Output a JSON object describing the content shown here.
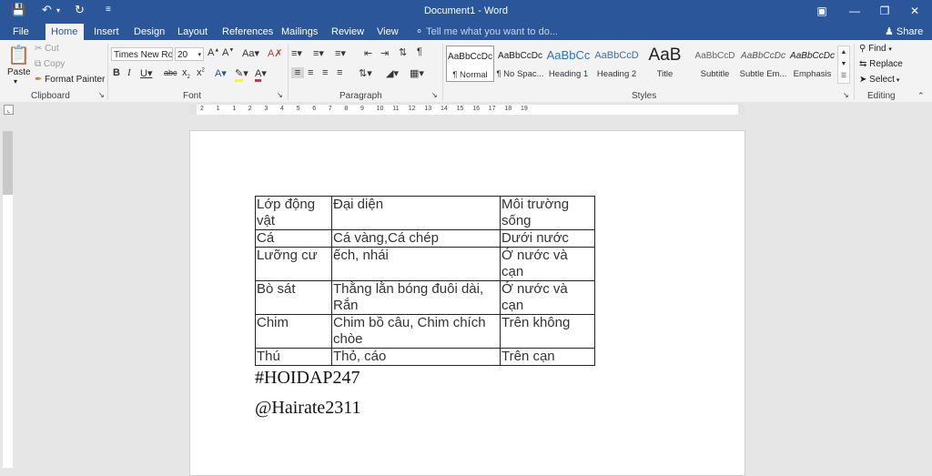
{
  "window": {
    "title": "Document1 - Word",
    "share_label": "Share"
  },
  "tabs": [
    {
      "label": "File"
    },
    {
      "label": "Home"
    },
    {
      "label": "Insert"
    },
    {
      "label": "Design"
    },
    {
      "label": "Layout"
    },
    {
      "label": "References"
    },
    {
      "label": "Mailings"
    },
    {
      "label": "Review"
    },
    {
      "label": "View"
    }
  ],
  "tell_me": "Tell me what you want to do...",
  "clipboard": {
    "paste": "Paste",
    "cut": "Cut",
    "copy": "Copy",
    "format_painter": "Format Painter",
    "group": "Clipboard"
  },
  "font": {
    "name": "Times New Ro",
    "size": "20",
    "group": "Font"
  },
  "paragraph": {
    "group": "Paragraph"
  },
  "styles": {
    "group": "Styles",
    "items": [
      {
        "sample": "AaBbCcDc",
        "name": "¶ Normal"
      },
      {
        "sample": "AaBbCcDc",
        "name": "¶ No Spac..."
      },
      {
        "sample": "AaBbCc",
        "name": "Heading 1"
      },
      {
        "sample": "AaBbCcD",
        "name": "Heading 2"
      },
      {
        "sample": "AaB",
        "name": "Title"
      },
      {
        "sample": "AaBbCcD",
        "name": "Subtitle"
      },
      {
        "sample": "AaBbCcDc",
        "name": "Subtle Em..."
      },
      {
        "sample": "AaBbCcDc",
        "name": "Emphasis"
      }
    ]
  },
  "editing": {
    "find": "Find",
    "replace": "Replace",
    "select": "Select",
    "group": "Editing"
  },
  "ruler_numbers": [
    "2",
    "1",
    "1",
    "2",
    "3",
    "4",
    "5",
    "6",
    "7",
    "8",
    "9",
    "10",
    "11",
    "12",
    "13",
    "14",
    "15",
    "16",
    "17",
    "18",
    "19"
  ],
  "table": {
    "rows": [
      [
        "Lớp động vật",
        "Đại diện",
        "Môi trường sống"
      ],
      [
        "Cá",
        "Cá vàng,Cá chép",
        "Dưới nước"
      ],
      [
        "Lưỡng cư",
        "ếch, nhái",
        "Ở nước và cạn"
      ],
      [
        "Bò sát",
        "Thằng lằn bóng đuôi dài, Rắn",
        "Ở nước và cạn"
      ],
      [
        "Chim",
        "Chim bồ câu, Chim chích chòe",
        "Trên không"
      ],
      [
        "Thú",
        "Thỏ, cáo",
        "Trên cạn"
      ]
    ]
  },
  "doc_lines": [
    "#HOIDAP247",
    "@Hairate2311"
  ],
  "colors": {
    "ribbon_blue": "#2b579a",
    "font_color_red": "#d13438",
    "highlight_yellow": "#ffff00"
  }
}
